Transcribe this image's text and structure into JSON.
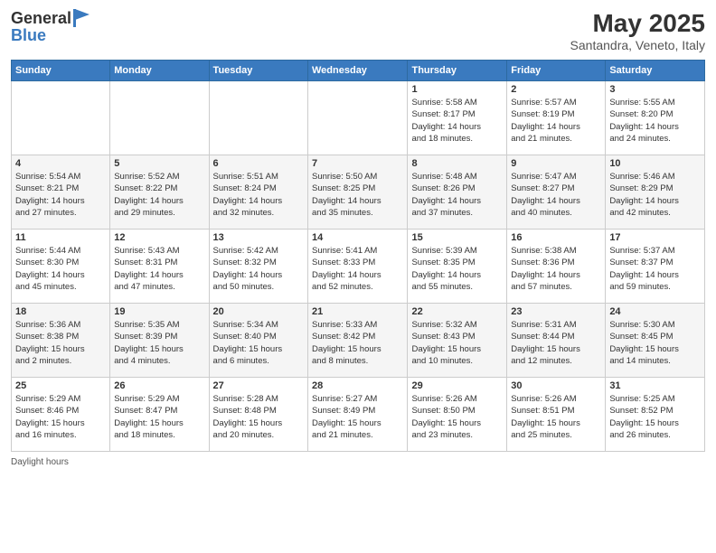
{
  "header": {
    "logo_line1": "General",
    "logo_line2": "Blue",
    "main_title": "May 2025",
    "subtitle": "Santandra, Veneto, Italy"
  },
  "days_of_week": [
    "Sunday",
    "Monday",
    "Tuesday",
    "Wednesday",
    "Thursday",
    "Friday",
    "Saturday"
  ],
  "weeks": [
    [
      {
        "day": "",
        "info": ""
      },
      {
        "day": "",
        "info": ""
      },
      {
        "day": "",
        "info": ""
      },
      {
        "day": "",
        "info": ""
      },
      {
        "day": "1",
        "info": "Sunrise: 5:58 AM\nSunset: 8:17 PM\nDaylight: 14 hours\nand 18 minutes."
      },
      {
        "day": "2",
        "info": "Sunrise: 5:57 AM\nSunset: 8:19 PM\nDaylight: 14 hours\nand 21 minutes."
      },
      {
        "day": "3",
        "info": "Sunrise: 5:55 AM\nSunset: 8:20 PM\nDaylight: 14 hours\nand 24 minutes."
      }
    ],
    [
      {
        "day": "4",
        "info": "Sunrise: 5:54 AM\nSunset: 8:21 PM\nDaylight: 14 hours\nand 27 minutes."
      },
      {
        "day": "5",
        "info": "Sunrise: 5:52 AM\nSunset: 8:22 PM\nDaylight: 14 hours\nand 29 minutes."
      },
      {
        "day": "6",
        "info": "Sunrise: 5:51 AM\nSunset: 8:24 PM\nDaylight: 14 hours\nand 32 minutes."
      },
      {
        "day": "7",
        "info": "Sunrise: 5:50 AM\nSunset: 8:25 PM\nDaylight: 14 hours\nand 35 minutes."
      },
      {
        "day": "8",
        "info": "Sunrise: 5:48 AM\nSunset: 8:26 PM\nDaylight: 14 hours\nand 37 minutes."
      },
      {
        "day": "9",
        "info": "Sunrise: 5:47 AM\nSunset: 8:27 PM\nDaylight: 14 hours\nand 40 minutes."
      },
      {
        "day": "10",
        "info": "Sunrise: 5:46 AM\nSunset: 8:29 PM\nDaylight: 14 hours\nand 42 minutes."
      }
    ],
    [
      {
        "day": "11",
        "info": "Sunrise: 5:44 AM\nSunset: 8:30 PM\nDaylight: 14 hours\nand 45 minutes."
      },
      {
        "day": "12",
        "info": "Sunrise: 5:43 AM\nSunset: 8:31 PM\nDaylight: 14 hours\nand 47 minutes."
      },
      {
        "day": "13",
        "info": "Sunrise: 5:42 AM\nSunset: 8:32 PM\nDaylight: 14 hours\nand 50 minutes."
      },
      {
        "day": "14",
        "info": "Sunrise: 5:41 AM\nSunset: 8:33 PM\nDaylight: 14 hours\nand 52 minutes."
      },
      {
        "day": "15",
        "info": "Sunrise: 5:39 AM\nSunset: 8:35 PM\nDaylight: 14 hours\nand 55 minutes."
      },
      {
        "day": "16",
        "info": "Sunrise: 5:38 AM\nSunset: 8:36 PM\nDaylight: 14 hours\nand 57 minutes."
      },
      {
        "day": "17",
        "info": "Sunrise: 5:37 AM\nSunset: 8:37 PM\nDaylight: 14 hours\nand 59 minutes."
      }
    ],
    [
      {
        "day": "18",
        "info": "Sunrise: 5:36 AM\nSunset: 8:38 PM\nDaylight: 15 hours\nand 2 minutes."
      },
      {
        "day": "19",
        "info": "Sunrise: 5:35 AM\nSunset: 8:39 PM\nDaylight: 15 hours\nand 4 minutes."
      },
      {
        "day": "20",
        "info": "Sunrise: 5:34 AM\nSunset: 8:40 PM\nDaylight: 15 hours\nand 6 minutes."
      },
      {
        "day": "21",
        "info": "Sunrise: 5:33 AM\nSunset: 8:42 PM\nDaylight: 15 hours\nand 8 minutes."
      },
      {
        "day": "22",
        "info": "Sunrise: 5:32 AM\nSunset: 8:43 PM\nDaylight: 15 hours\nand 10 minutes."
      },
      {
        "day": "23",
        "info": "Sunrise: 5:31 AM\nSunset: 8:44 PM\nDaylight: 15 hours\nand 12 minutes."
      },
      {
        "day": "24",
        "info": "Sunrise: 5:30 AM\nSunset: 8:45 PM\nDaylight: 15 hours\nand 14 minutes."
      }
    ],
    [
      {
        "day": "25",
        "info": "Sunrise: 5:29 AM\nSunset: 8:46 PM\nDaylight: 15 hours\nand 16 minutes."
      },
      {
        "day": "26",
        "info": "Sunrise: 5:29 AM\nSunset: 8:47 PM\nDaylight: 15 hours\nand 18 minutes."
      },
      {
        "day": "27",
        "info": "Sunrise: 5:28 AM\nSunset: 8:48 PM\nDaylight: 15 hours\nand 20 minutes."
      },
      {
        "day": "28",
        "info": "Sunrise: 5:27 AM\nSunset: 8:49 PM\nDaylight: 15 hours\nand 21 minutes."
      },
      {
        "day": "29",
        "info": "Sunrise: 5:26 AM\nSunset: 8:50 PM\nDaylight: 15 hours\nand 23 minutes."
      },
      {
        "day": "30",
        "info": "Sunrise: 5:26 AM\nSunset: 8:51 PM\nDaylight: 15 hours\nand 25 minutes."
      },
      {
        "day": "31",
        "info": "Sunrise: 5:25 AM\nSunset: 8:52 PM\nDaylight: 15 hours\nand 26 minutes."
      }
    ]
  ],
  "footer": {
    "daylight_label": "Daylight hours"
  }
}
